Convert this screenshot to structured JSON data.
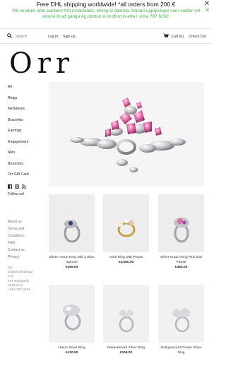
{
  "announcement": {
    "line1": "Free DHL shipping worldwide! *all orders from 200 €",
    "line2": "Við sendum allar pantanir frítt innanlands, einnig til útlanda. Nánari upplýsingar sem varðar við skilvísi til að ganga ég pöntun á orr@orr.is eða í síma 787 6262.",
    "close_glyph": "✕"
  },
  "header": {
    "search_placeholder": "Search",
    "login": "Log in",
    "signup": "Sign up",
    "cart": "Cart (0)",
    "checkout": "Check Out"
  },
  "logo": "Orr",
  "sidebar": {
    "nav": [
      "All",
      "Rings",
      "Necklaces",
      "Bracelets",
      "Earrings",
      "Engagement",
      "Men",
      "Brooches",
      "Orr Gift Card"
    ],
    "follow": "Follow us!",
    "footer_links": [
      "About us",
      "Terms and",
      "Conditions",
      "FAQ",
      "Contact us",
      "Privacy"
    ],
    "address": [
      "Orr",
      "Skólavörðustígur",
      "17b",
      "101 Reykjavík",
      "orr@orr.is",
      "+354 787 6262"
    ]
  },
  "products": [
    {
      "name": "Silver Hraun Ring with a Blue Spinnel",
      "price": "€265.00"
    },
    {
      "name": "Gold Ring with Pearls",
      "price": "€2,650.00"
    },
    {
      "name": "Silver Hraun Ring Pink and Purple",
      "price": "€460.00"
    },
    {
      "name": "Hraun Silver Ring",
      "price": "€410.00"
    },
    {
      "name": "Deliquescent Silver Ring",
      "price": "€195.00"
    },
    {
      "name": "Deliquescent Flower Silver Ring",
      "price": ""
    }
  ],
  "colors": {
    "accent_green": "#43b24a",
    "text": "#222222",
    "muted": "#888888"
  },
  "icons": {
    "search": "search-icon",
    "cart": "cart-icon",
    "facebook": "facebook-icon",
    "instagram": "instagram-icon",
    "rss": "rss-icon"
  }
}
